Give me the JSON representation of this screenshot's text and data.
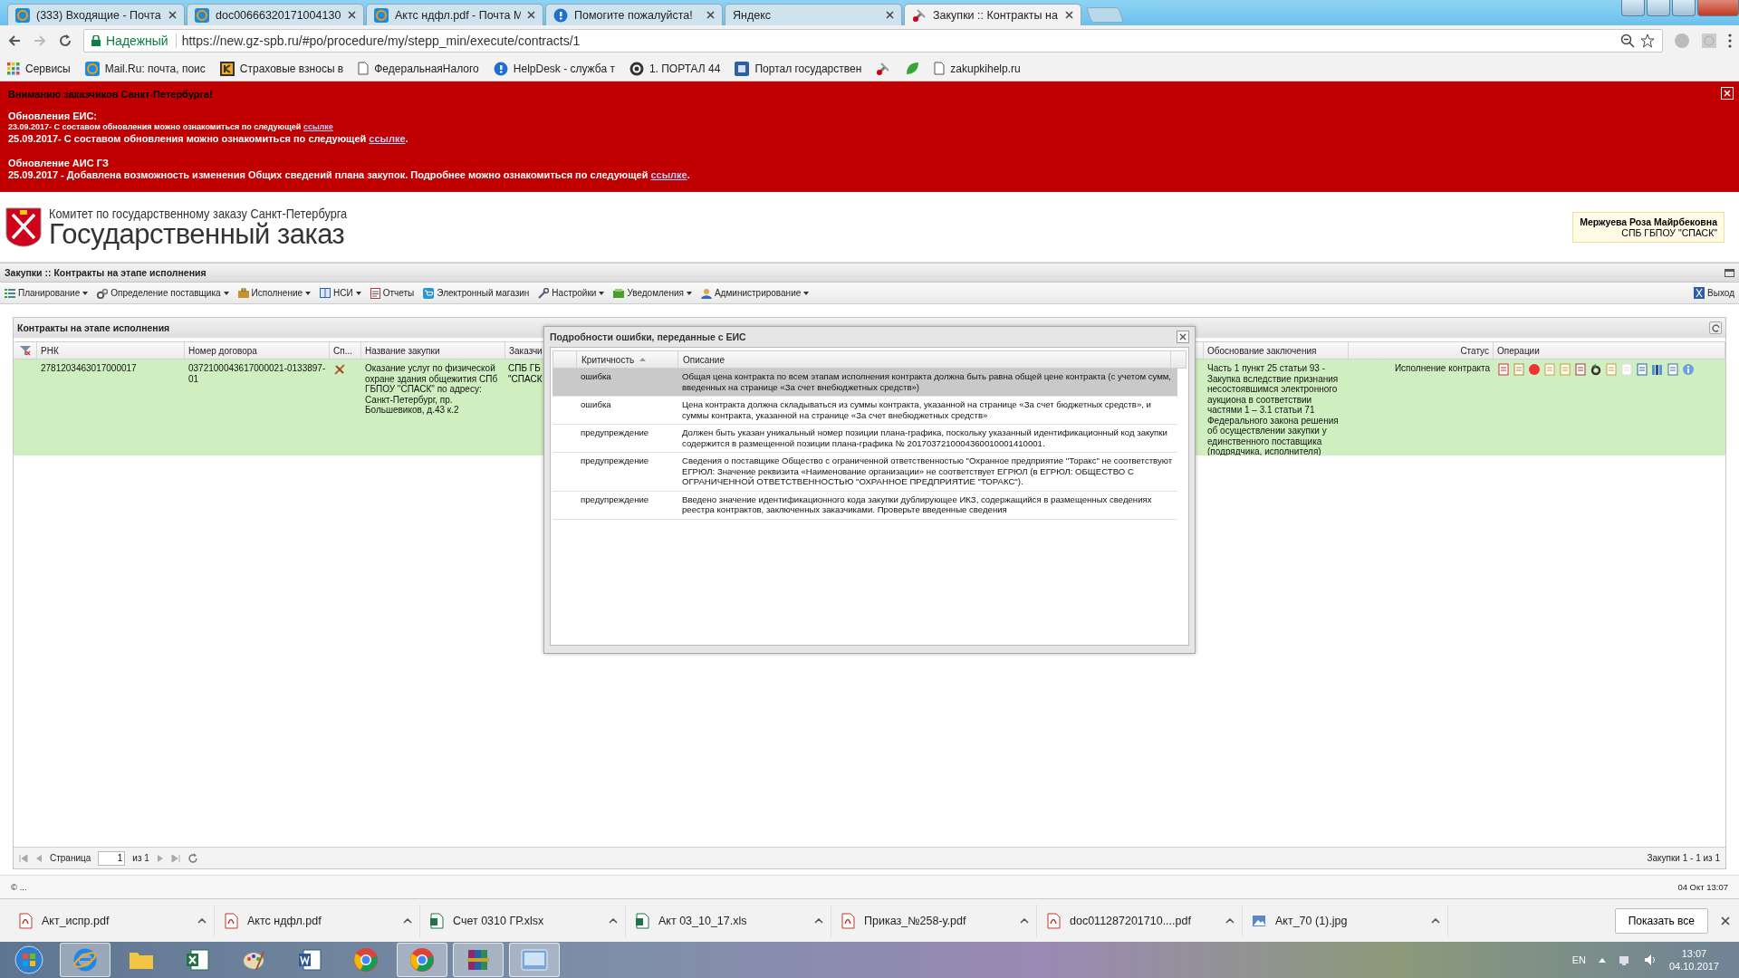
{
  "browser": {
    "tabs": [
      {
        "title": "(333) Входящие - Почта",
        "kind": "mail",
        "selected": false
      },
      {
        "title": "doc00666320171004130",
        "kind": "mail",
        "selected": false
      },
      {
        "title": "Актс ндфл.pdf - Почта М",
        "kind": "mail",
        "selected": false
      },
      {
        "title": "Помогите пожалуйста!",
        "kind": "help",
        "selected": false
      },
      {
        "title": "Яндекс",
        "kind": "plain",
        "selected": false
      },
      {
        "title": "Закупки :: Контракты на",
        "kind": "tool",
        "selected": true
      }
    ],
    "address": {
      "secure_label": "Надежный",
      "url": "https://new.gz-spb.ru/#po/procedure/my/stepp_min/execute/contracts/1"
    },
    "bookmarks": [
      {
        "title": "Сервисы",
        "kind": "apps"
      },
      {
        "title": "Mail.Ru: почта, поис",
        "kind": "mail"
      },
      {
        "title": "Страховые взносы в",
        "kind": "k"
      },
      {
        "title": "ФедеральнаяНалого",
        "kind": "doc"
      },
      {
        "title": "HelpDesk - служба т",
        "kind": "help"
      },
      {
        "title": "1. ПОРТАЛ 44",
        "kind": "c"
      },
      {
        "title": "Портал государствен",
        "kind": "gz"
      },
      {
        "kind": "tool"
      },
      {
        "kind": "leaf"
      },
      {
        "title": "zakupkihelp.ru",
        "kind": "doc"
      }
    ]
  },
  "banner": {
    "title": "Вниманию заказчиков Санкт-Петербурга!",
    "sections": [
      {
        "heading": "Обновления ЕИС:",
        "lines": [
          {
            "text": "23.09.2017- С составом обновления можно ознакомиться по следующей ",
            "link": "ссылке",
            "small": true
          },
          {
            "text": "25.09.2017- С составом обновления можно ознакомиться по следующей ",
            "link": "ссылке",
            "tail": ".",
            "small": false
          }
        ]
      },
      {
        "heading": "Обновление АИС ГЗ",
        "lines": [
          {
            "text": "25.09.2017 - Добавлена возможность изменения Общих сведений плана закупок. Подробнее можно ознакомиться по следующей ",
            "link": "ссылке",
            "tail": ".",
            "small": false
          }
        ]
      }
    ]
  },
  "header": {
    "org": "Комитет по государственному заказу Санкт-Петербурга",
    "title": "Государственный заказ",
    "user": {
      "name": "Мержуева Роза Майрбековна",
      "org": "СПБ ГБПОУ \"СПАСК\""
    }
  },
  "page_title": "Закупки :: Контракты на этапе исполнения",
  "menu": [
    {
      "label": "Планирование",
      "kind": "planning",
      "dropdown": true
    },
    {
      "label": "Определение поставщика",
      "kind": "gears",
      "dropdown": true
    },
    {
      "label": "Исполнение",
      "kind": "execution",
      "dropdown": true
    },
    {
      "label": "НСИ",
      "kind": "book",
      "dropdown": true
    },
    {
      "label": "Отчеты",
      "kind": "report",
      "dropdown": false
    },
    {
      "label": "Электронный магазин",
      "kind": "cart",
      "dropdown": false
    },
    {
      "label": "Настройки",
      "kind": "wrench",
      "dropdown": true
    },
    {
      "label": "Уведомления",
      "kind": "notify",
      "dropdown": true
    },
    {
      "label": "Администрирование",
      "kind": "user",
      "dropdown": true
    }
  ],
  "logout": "Выход",
  "grid": {
    "title": "Контракты на этапе исполнения",
    "columns": [
      "РНК",
      "Номер договора",
      "Сп...",
      "Название закупки",
      "Заказчи",
      "Обоснование заключения",
      "Статус",
      "Операции"
    ],
    "rows": [
      {
        "selected": true,
        "rnk": "2781203463017000017",
        "contract_number": "0372100043617000021-0133897-01",
        "name": "Оказание услуг по физической охране здания общежития СПб ГБПОУ \"СПАСК\" по адресу: Санкт-Петербург, пр. Большевиков, д.43 к.2",
        "customer": [
          "СПБ ГБ",
          "\"СПАСК"
        ],
        "basis": "Часть 1 пункт 25 статьи 93 - Закупка вследствие признания несостоявшимся электронного аукциона в соответствии частями 1 – 3.1 статьи 71 Федерального закона решения об осуществлении закупки у единственного поставщика (подрядчика, исполнителя)",
        "status": "Исполнение контракта"
      }
    ],
    "pager": {
      "page_label": "Страница",
      "page": "1",
      "of": "из 1",
      "summary": "Закупки 1 - 1 из 1"
    }
  },
  "dialog": {
    "title": "Подробности ошибки, переданные с ЕИС",
    "columns": [
      "Критичность",
      "Описание"
    ],
    "rows": [
      {
        "severity": "ошибка",
        "description": "Общая цена контракта по всем этапам исполнения контракта должна быть равна общей цене контракта (с учетом сумм, введенных на странице «За счет внебюджетных средств»)",
        "selected": true
      },
      {
        "severity": "ошибка",
        "description": "Цена контракта должна складываться из суммы контракта, указанной на странице «За счет бюджетных средств», и суммы контракта, указанной на странице «За счет внебюджетных средств»",
        "selected": false
      },
      {
        "severity": "предупреждение",
        "description": "Должен быть указан уникальный номер позиции плана-графика, поскольку указанный идентификационный код закупки содержится в размещенной позиции плана-графика № 2017037210004360010001410001.",
        "selected": false
      },
      {
        "severity": "предупреждение",
        "description": "Сведения о поставщике Общество с ограниченной ответственностью \"Охранное предприятие \"Торакс\" не соответствуют ЕГРЮЛ: Значение реквизита «Наименование организации» не соответствует ЕГРЮЛ (в ЕГРЮЛ: ОБЩЕСТВО С ОГРАНИЧЕННОЙ ОТВЕТСТВЕННОСТЬЮ \"ОХРАННОЕ ПРЕДПРИЯТИЕ \"ТОРАКС\").",
        "selected": false
      },
      {
        "severity": "предупреждение",
        "description": "Введено значение идентификационного кода закупки дублирующее ИКЗ, содержащийся в размещенных сведениях реестра контрактов, заключенных заказчиками. Проверьте введенные сведения",
        "selected": false
      }
    ]
  },
  "status_bar": {
    "left": "© ...",
    "right": "04 Окт 13:07"
  },
  "downloads": {
    "files": [
      {
        "name": "Акт_испр.pdf",
        "kind": "pdf"
      },
      {
        "name": "Актс ндфл.pdf",
        "kind": "pdf"
      },
      {
        "name": "Счет 0310 ГР.xlsx",
        "kind": "xls"
      },
      {
        "name": "Акт 03_10_17.xls",
        "kind": "xls"
      },
      {
        "name": "Приказ_№258-у.pdf",
        "kind": "pdf"
      },
      {
        "name": "doc011287201710....pdf",
        "kind": "pdf"
      },
      {
        "name": "Акт_70 (1).jpg",
        "kind": "img"
      }
    ],
    "show_all": "Показать все"
  },
  "taskbar": {
    "apps": [
      {
        "kind": "start",
        "active": false
      },
      {
        "kind": "ie",
        "active": true
      },
      {
        "kind": "folder",
        "active": false
      },
      {
        "kind": "excel",
        "active": false
      },
      {
        "kind": "paint",
        "active": false
      },
      {
        "kind": "word",
        "active": false
      },
      {
        "kind": "chrome",
        "active": false
      },
      {
        "kind": "chrome",
        "active": true
      },
      {
        "kind": "winrar",
        "active": true
      },
      {
        "kind": "screen",
        "active": true
      }
    ],
    "language": "EN",
    "time": "13:07",
    "date": "04.10.2017"
  }
}
